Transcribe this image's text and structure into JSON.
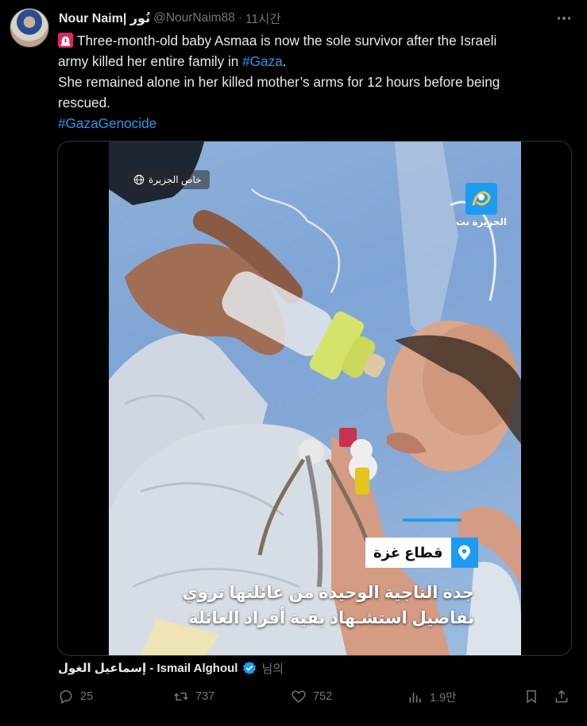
{
  "tweet": {
    "author_name": "Nour Naim| نُور",
    "author_handle": "@NourNaim88",
    "separator": "·",
    "time": "11시간",
    "text_lines": {
      "l1": "Three-month-old baby Asmaa is now the sole survivor after the Israeli",
      "l2a": "army killed her entire family in ",
      "l2_link": "#Gaza",
      "l2b": ".",
      "l3": "She remained alone in her killed mother’s arms for 12 hours before being",
      "l4": "rescued.",
      "hashtag": "#GazaGenocide"
    }
  },
  "media": {
    "tag_text": "خاص الجزيرة",
    "logo_text": "الجزيرة نت",
    "location": "قطاع غزة",
    "caption_line1": "جدة الناجية الوحيدة من عائلتها تروي",
    "caption_line2": "تفاصيل استشـهاد بقية أفراد العائلة",
    "accent_color": "#1d9bf0"
  },
  "attribution": {
    "person": "إسماعيل الغول - Ismail Alghoul",
    "suffix": "님의"
  },
  "actions": {
    "replies": "25",
    "reposts": "737",
    "likes": "752",
    "views": "1.9만"
  },
  "icons": [
    "siren-icon",
    "more-icon",
    "globe-icon",
    "location-pin-icon",
    "verified-badge-icon",
    "reply-icon",
    "repost-icon",
    "like-icon",
    "views-icon",
    "bookmark-icon",
    "share-icon"
  ]
}
